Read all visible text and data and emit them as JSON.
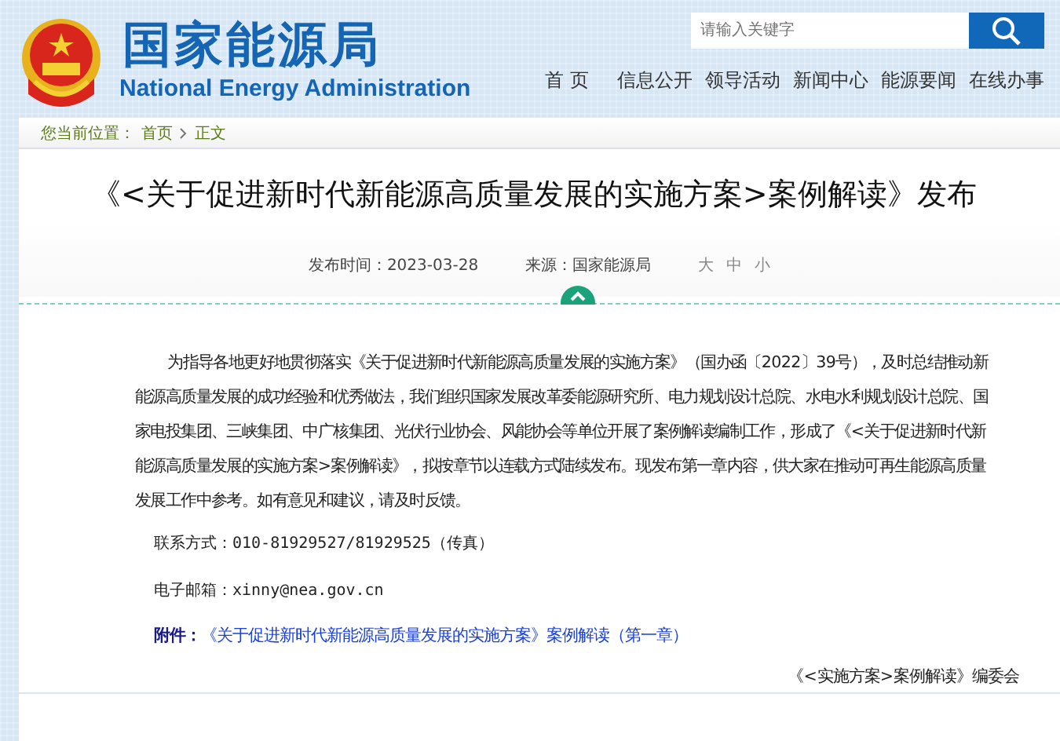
{
  "header": {
    "logo_title": "国家能源局",
    "logo_subtitle": "National Energy Administration",
    "search": {
      "placeholder": "请输入关键字"
    },
    "nav": [
      {
        "label": "首 页"
      },
      {
        "label": "信息公开"
      },
      {
        "label": "领导活动"
      },
      {
        "label": "新闻中心"
      },
      {
        "label": "能源要闻"
      },
      {
        "label": "在线办事"
      }
    ]
  },
  "breadcrumb": {
    "label": "您当前位置：",
    "items": [
      "首页",
      "正文"
    ]
  },
  "article": {
    "title": "《<关于促进新时代新能源高质量发展的实施方案>案例解读》发布",
    "meta": {
      "date": "发布时间：2023-03-28",
      "source": "来源：国家能源局",
      "font_sizes": [
        "大",
        "中",
        "小"
      ]
    },
    "paragraph": "为指导各地更好地贯彻落实《关于促进新时代新能源高质量发展的实施方案》（国办函〔2022〕39号），及时总结推动新能源高质量发展的成功经验和优秀做法，我们组织国家发展改革委能源研究所、电力规划设计总院、水电水利规划设计总院、国家电投集团、三峡集团、中广核集团、光伏行业协会、风能协会等单位开展了案例解读编制工作，形成了《<关于促进新时代新能源高质量发展的实施方案>案例解读》，拟按章节以连载方式陆续发布。现发布第一章内容，供大家在推动可再生能源高质量发展工作中参考。如有意见和建议，请及时反馈。",
    "contact": "联系方式：010-81929527/81929525（传真）",
    "email": "电子邮箱：xinny@nea.gov.cn",
    "attachment": {
      "label": "附件：",
      "link": "《关于促进新时代新能源高质量发展的实施方案》案例解读（第一章）"
    },
    "signature": "《<实施方案>案例解读》编委会"
  }
}
